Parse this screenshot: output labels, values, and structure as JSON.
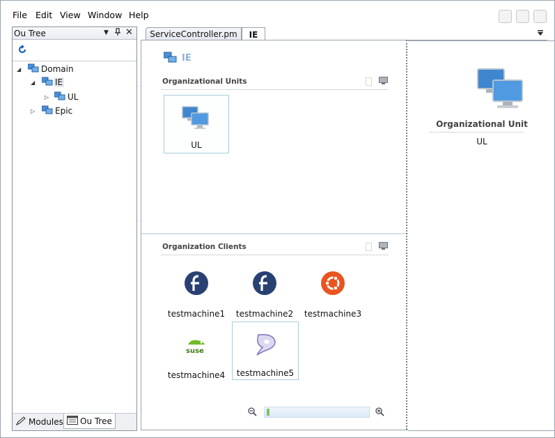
{
  "menu": {
    "file": "File",
    "edit": "Edit",
    "view": "View",
    "window": "Window",
    "help": "Help"
  },
  "ou_tree": {
    "title": "Ou Tree",
    "nodes": {
      "domain": "Domain",
      "ie": "IE",
      "ul": "UL",
      "epic": "Epic"
    },
    "tabs": {
      "modules": "Modules",
      "ou_tree": "Ou Tree"
    }
  },
  "doc_tabs": {
    "service_controller": "ServiceController.pm",
    "ie": "IE"
  },
  "main": {
    "header_title": "IE",
    "org_units": {
      "heading": "Organizational Units",
      "items": [
        "UL"
      ]
    },
    "clients": {
      "heading": "Organization Clients",
      "items": [
        {
          "name": "testmachine1",
          "icon": "fedora-icon"
        },
        {
          "name": "testmachine2",
          "icon": "fedora-icon"
        },
        {
          "name": "testmachine3",
          "icon": "ubuntu-icon"
        },
        {
          "name": "testmachine4",
          "icon": "suse-icon"
        },
        {
          "name": "testmachine5",
          "icon": "gentoo-icon"
        }
      ]
    },
    "zoom": {
      "level": 0.02
    }
  },
  "details": {
    "type_label": "Organizational Unit",
    "name_value": "UL"
  },
  "colors": {
    "tile_border": "#a8cdd8",
    "fedora": "#294172",
    "ubuntu": "#e95420",
    "suse": "#73ba25"
  }
}
